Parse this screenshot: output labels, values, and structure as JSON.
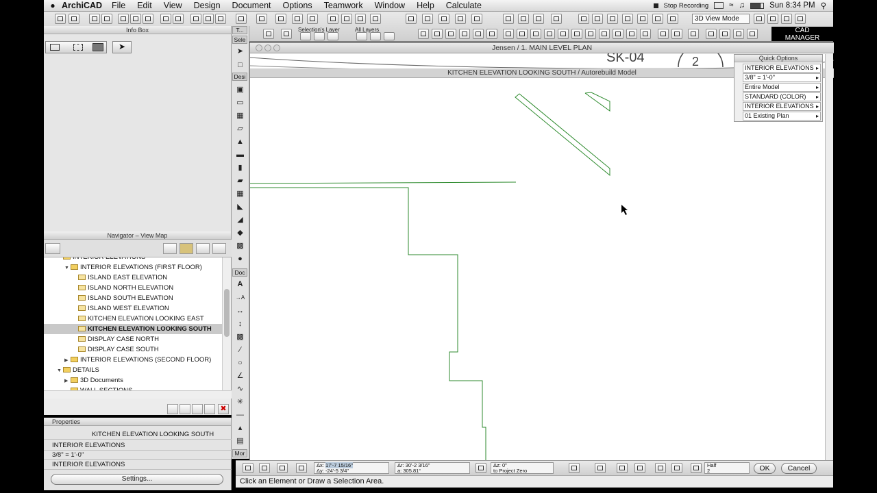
{
  "menubar": {
    "app_name": "ArchiCAD",
    "items": [
      "File",
      "Edit",
      "View",
      "Design",
      "Document",
      "Options",
      "Teamwork",
      "Window",
      "Help",
      "Calculate"
    ],
    "stop_recording": "Stop Recording",
    "clock": "Sun 8:34 PM"
  },
  "toolbar": {
    "view_mode": "3D View Mode",
    "layer_label": "Selection's Layer",
    "all_layers_label": "All Layers",
    "brand_line1": "CAD",
    "brand_line2": "MANAGER"
  },
  "infobox": {
    "title": "Info Box"
  },
  "navigator": {
    "title": "Navigator – View Map",
    "tree": [
      {
        "label": "INTERIOR ELEVATIONS",
        "indent": 1,
        "type": "folder-partial"
      },
      {
        "label": "INTERIOR ELEVATIONS (FIRST FLOOR)",
        "indent": 2,
        "type": "folder-open"
      },
      {
        "label": "ISLAND EAST ELEVATION",
        "indent": 3,
        "type": "view"
      },
      {
        "label": "ISLAND NORTH ELEVATION",
        "indent": 3,
        "type": "view"
      },
      {
        "label": "ISLAND SOUTH ELEVATION",
        "indent": 3,
        "type": "view"
      },
      {
        "label": "ISLAND WEST ELEVATION",
        "indent": 3,
        "type": "view"
      },
      {
        "label": "KITCHEN ELEVATION LOOKING EAST",
        "indent": 3,
        "type": "view"
      },
      {
        "label": "KITCHEN ELEVATION LOOKING SOUTH",
        "indent": 3,
        "type": "view",
        "selected": true
      },
      {
        "label": "DISPLAY CASE NORTH",
        "indent": 3,
        "type": "view"
      },
      {
        "label": "DISPLAY CASE SOUTH",
        "indent": 3,
        "type": "view"
      },
      {
        "label": "INTERIOR ELEVATIONS (SECOND FLOOR)",
        "indent": 2,
        "type": "folder"
      },
      {
        "label": "DETAILS",
        "indent": 1,
        "type": "folder-open"
      },
      {
        "label": "3D Documents",
        "indent": 2,
        "type": "folder"
      },
      {
        "label": "WALL SECTIONS",
        "indent": 2,
        "type": "folder-partial"
      }
    ]
  },
  "properties": {
    "title": "Properties",
    "name_value": "KITCHEN ELEVATION LOOKING SOUTH",
    "layer": "INTERIOR ELEVATIONS",
    "scale": "3/8\"   =    1'-0\"",
    "layer2": "INTERIOR ELEVATIONS",
    "settings_label": "Settings..."
  },
  "toolbox": {
    "labels": [
      "T...",
      "Sele",
      "Desi",
      "Doc",
      "Mor"
    ]
  },
  "window": {
    "title": "Jensen / 1. MAIN LEVEL PLAN",
    "subtitle": "KITCHEN ELEVATION LOOKING SOUTH / Autorebuild Model",
    "sheet_tag": "SK-04",
    "sheet_number": "2"
  },
  "quick_options": {
    "title": "Quick Options",
    "rows": [
      "INTERIOR ELEVATIONS",
      "3/8\"   =    1'-0\"",
      "Entire Model",
      "STANDARD (COLOR)",
      "INTERIOR ELEVATIONS",
      "01 Existing Plan"
    ]
  },
  "coords": {
    "dx_label": "Δx:",
    "dx": "17'-7 15/16\"",
    "dy_label": "Δy:",
    "dy": "-24'-5 3/4\"",
    "dr_label": "Δr:",
    "dr": "30'-2 3/16\"",
    "a_label": "a:",
    "a": "305.81°",
    "dz_label": "Δz:",
    "dz": "0\"",
    "project_zero": "to Project Zero",
    "half_label": "Half",
    "half_value": "2",
    "ok": "OK",
    "cancel": "Cancel"
  },
  "status": {
    "text": "Click an Element or Draw a Selection Area."
  }
}
